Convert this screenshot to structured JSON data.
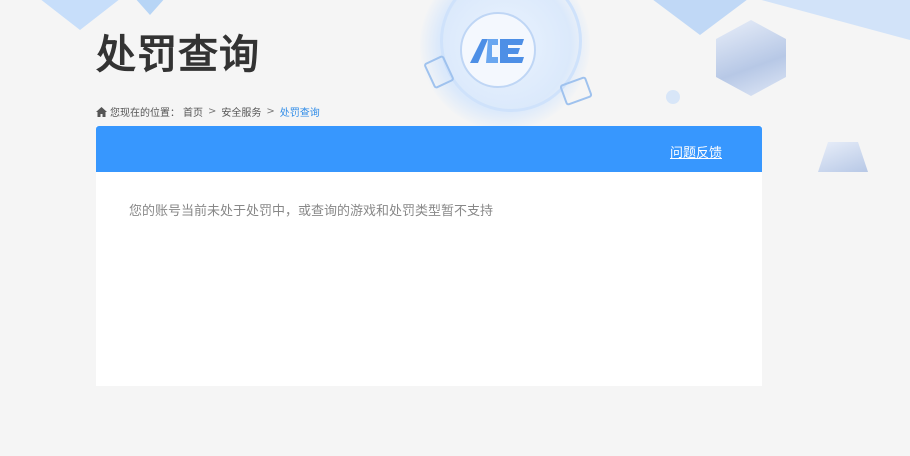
{
  "page": {
    "title": "处罚查询",
    "logo_text": "ACE"
  },
  "breadcrumb": {
    "prefix": "您现在的位置：",
    "items": [
      "首页",
      "安全服务",
      "处罚查询"
    ],
    "separator": ">"
  },
  "panel": {
    "feedback_link": "问题反馈",
    "message": "您的账号当前未处于处罚中，或查询的游戏和处罚类型暂不支持"
  },
  "colors": {
    "header_blue": "#3797fe",
    "breadcrumb_current": "#2f8ce8"
  }
}
